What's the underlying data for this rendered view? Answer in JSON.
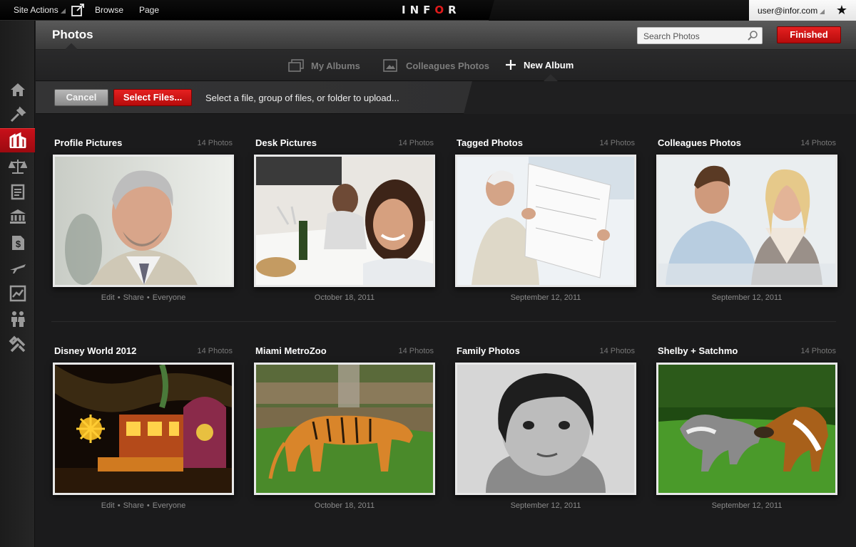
{
  "topbar": {
    "site_actions": "Site Actions",
    "browse": "Browse",
    "page": "Page",
    "logo": "INFOR",
    "user": "user@infor.com"
  },
  "header": {
    "title": "Photos",
    "search_placeholder": "Search Photos",
    "finished": "Finished"
  },
  "tabs": [
    {
      "label": "My Albums"
    },
    {
      "label": "Colleagues Photos"
    },
    {
      "label": "New Album"
    }
  ],
  "upload": {
    "cancel": "Cancel",
    "select_files": "Select Files...",
    "hint": "Select a file, group of files, or folder to upload..."
  },
  "sidebar": [
    "home-icon",
    "tools-icon",
    "buildings-icon",
    "scales-icon",
    "clipboard-icon",
    "bank-icon",
    "invoice-icon",
    "plane-icon",
    "chart-icon",
    "people-icon",
    "wrench-icon"
  ],
  "albums": [
    {
      "name": "Profile Pictures",
      "count": "14 Photos",
      "edit": "Edit",
      "share": "Share",
      "visibility": "Everyone"
    },
    {
      "name": "Desk Pictures",
      "count": "14 Photos",
      "date": "October 18, 2011"
    },
    {
      "name": "Tagged Photos",
      "count": "14 Photos",
      "date": "September 12, 2011"
    },
    {
      "name": "Colleagues Photos",
      "count": "14 Photos",
      "date": "September 12, 2011"
    },
    {
      "name": "Disney World 2012",
      "count": "14 Photos",
      "edit": "Edit",
      "share": "Share",
      "visibility": "Everyone"
    },
    {
      "name": "Miami MetroZoo",
      "count": "14 Photos",
      "date": "October 18, 2011"
    },
    {
      "name": "Family Photos",
      "count": "14 Photos",
      "date": "September 12, 2011"
    },
    {
      "name": "Shelby + Satchmo",
      "count": "14 Photos",
      "date": "September 12, 2011"
    }
  ],
  "colors": {
    "accent": "#d41414",
    "background": "#1b1b1c"
  }
}
